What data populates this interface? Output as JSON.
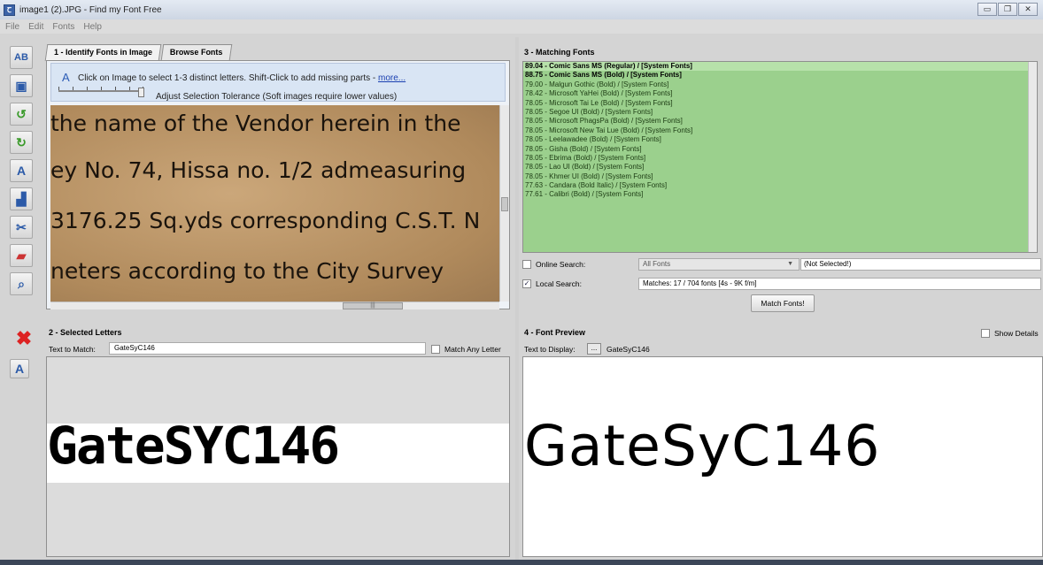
{
  "window": {
    "title": "image1 (2).JPG - Find my Font Free",
    "app_icon": "font-app-icon"
  },
  "menu": [
    "File",
    "Edit",
    "Fonts",
    "Help"
  ],
  "tabs": [
    "1 - Identify Fonts in Image",
    "Browse Fonts"
  ],
  "identify": {
    "hint": "Click on Image to select 1-3 distinct letters. Shift-Click to add missing parts - ",
    "hint_link": "more...",
    "tolerance_label": "Adjust Selection Tolerance (Soft images require lower values)",
    "image_lines": [
      "the name of the Vendor herein in the",
      "ey No. 74, Hissa no. 1/2 admeasuring",
      "3176.25  Sq.yds  corresponding  C.S.T.  N",
      "neters according to the City Survey"
    ]
  },
  "matching": {
    "title": "3 - Matching Fonts",
    "results": [
      "89.04 - Comic Sans MS (Regular) / [System Fonts]",
      "88.75 - Comic Sans MS (Bold) / [System Fonts]",
      "79.00 - Malgun Gothic (Bold) / [System Fonts]",
      "78.42 - Microsoft YaHei (Bold) / [System Fonts]",
      "78.05 - Microsoft Tai Le (Bold) / [System Fonts]",
      "78.05 - Segoe UI (Bold) / [System Fonts]",
      "78.05 - Microsoft PhagsPa (Bold) / [System Fonts]",
      "78.05 - Microsoft New Tai Lue (Bold) / [System Fonts]",
      "78.05 - Leelawadee (Bold) / [System Fonts]",
      "78.05 - Gisha (Bold) / [System Fonts]",
      "78.05 - Ebrima (Bold) / [System Fonts]",
      "78.05 - Lao UI (Bold) / [System Fonts]",
      "78.05 - Khmer UI (Bold) / [System Fonts]",
      "77.63 - Candara (Bold Italic) / [System Fonts]",
      "77.61 - Calibri (Bold) / [System Fonts]"
    ],
    "online_label": "Online Search:",
    "online_select": "All Fonts",
    "online_value": "(Not Selected!)",
    "local_label": "Local Search:",
    "local_value": "Matches: 17 / 704 fonts [4s - 9K f/m]",
    "match_button": "Match Fonts!"
  },
  "selected": {
    "title": "2 - Selected Letters",
    "text_label": "Text to Match:",
    "text_value": "GateSyC146",
    "any_letter": "Match Any Letter",
    "display": "GateSYC146"
  },
  "preview": {
    "title": "4 - Font Preview",
    "show_details": "Show Details",
    "text_label": "Text to Display:",
    "dots": "...",
    "text_value": "GateSyC146",
    "display": "GateSyC146"
  },
  "colors": {
    "match_list_bg": "#9bd08d",
    "remove_icon": "#d22222"
  }
}
